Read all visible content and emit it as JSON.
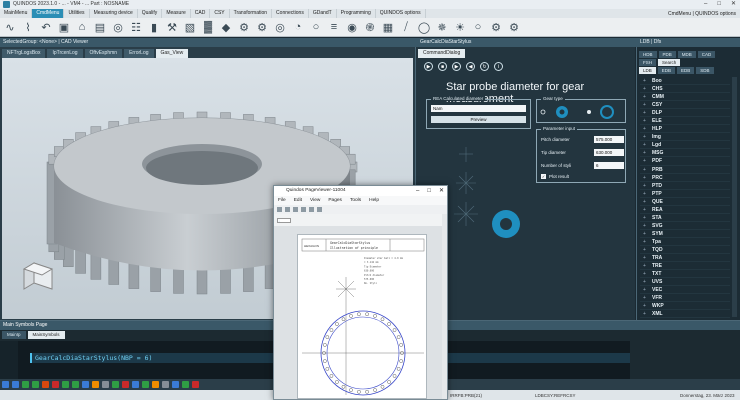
{
  "window": {
    "title": "QUINDOS 2023.1.0 - ... - VM4 - ...  Part : NOSNAME",
    "minimize": "–",
    "maximize": "□",
    "close": "✕"
  },
  "menubar": {
    "items": [
      "MainMenu",
      "CmdMenu",
      "Utilities",
      "Measuring device",
      "Qualify",
      "Measure",
      "CAD",
      "CSY",
      "Transformation",
      "Connections",
      "GDandT",
      "Programming",
      "QUINDOS options"
    ],
    "active_index": 1,
    "right_label": "CmdMenu | QUINDOS options"
  },
  "toolbar": {
    "icons": [
      "curve-icon",
      "zigzag-icon",
      "undo-arrow-icon",
      "stamp-icon",
      "tag-icon",
      "folder-icon",
      "globe-icon",
      "hierarchy-icon",
      "cylinder-icon",
      "crane-icon",
      "cube-icon",
      "factory-icon",
      "drop-icon",
      "gear-icon",
      "gear-outline-icon",
      "gear-ring-icon",
      "dial-icon",
      "circle-icon",
      "lines-icon",
      "knob-icon",
      "spiral-icon",
      "grid-icon",
      "slash-icon",
      "ring-icon",
      "star-gear-icon",
      "sun-icon",
      "ring-icon-2",
      "gear-set-icon",
      "gear-outline-icon-2"
    ]
  },
  "header_strip": {
    "left": "SelectedGroup: <None> | CAD Viewer",
    "center": "GearCalcDiaStarStylus",
    "right": "LDB | Dfs"
  },
  "view_tabs": [
    "NFTrgLogsBox",
    "IpTrcenLog",
    "OftvEsphmn",
    "ErrorLog",
    "Gas_View"
  ],
  "view_tabs_active": 4,
  "center": {
    "tab": "CommandDialog",
    "title": "Star probe diameter for gear measurement",
    "calc_group": "REA Calculated diameter",
    "calc_select": "Nam",
    "preview_button": "Preview",
    "gear_type_group": "Gear type",
    "param_group": "Parameter input",
    "params": [
      {
        "label": "Pitch diameter",
        "value": "575.000"
      },
      {
        "label": "Tip diameter",
        "value": "630.000"
      },
      {
        "label": "Number of styli",
        "value": "6"
      }
    ],
    "plot_result": "Plot result"
  },
  "right_panel": {
    "tabs_row1": [
      "HDB",
      "PDB",
      "MDB",
      "CAD"
    ],
    "tabs_row2": [
      "FSH",
      "Search"
    ],
    "tabs_row3": [
      "LDB",
      "EDB",
      "EDB",
      "SDB"
    ],
    "items": [
      "Boo",
      "CHS",
      "CMM",
      "CSY",
      "DLP",
      "ELE",
      "HLP",
      "Img",
      "Lgd",
      "MSG",
      "PDF",
      "PRB",
      "PRC",
      "PTD",
      "PTP",
      "QUE",
      "REA",
      "STA",
      "SVG",
      "SYM",
      "Tpa",
      "TQD",
      "TRA",
      "TRE",
      "TXT",
      "UVS",
      "VEC",
      "VFR",
      "WKP",
      "XML"
    ]
  },
  "bottom": {
    "header": "Main Symbols Page",
    "tabs": [
      "MainIp",
      "MainSymbols"
    ],
    "code_line": "GearCalcDiaStarStylus(NBP = 6)",
    "status_left": "IRRFB:PRB(21)",
    "status_mid": "LDBCSY:REFRCSY",
    "status_right": "Donnerstag, 23. März 2023"
  },
  "page_viewer": {
    "title": "Quindos PageViewer-11004",
    "menu": [
      "File",
      "Edit",
      "View",
      "Pages",
      "Tools",
      "Help"
    ],
    "zoom": "1",
    "doc_title": "GearCalcDiaStarStylus",
    "doc_subtitle": "Illustration of principle",
    "doc_logo": "HEXAGON",
    "doc_lines": [
      "Diameter star ball = 4.0 mm",
      "= 3.142 mm",
      "Tip Diameter",
      "630.000",
      "Pitch diameter",
      "575.000",
      "No. Styli"
    ]
  },
  "colors": {
    "accent": "#2b8eb5",
    "panel_dark": "#1c2c35",
    "gear_blue": "#1f8fc0",
    "code_text": "#6fd1f5"
  }
}
